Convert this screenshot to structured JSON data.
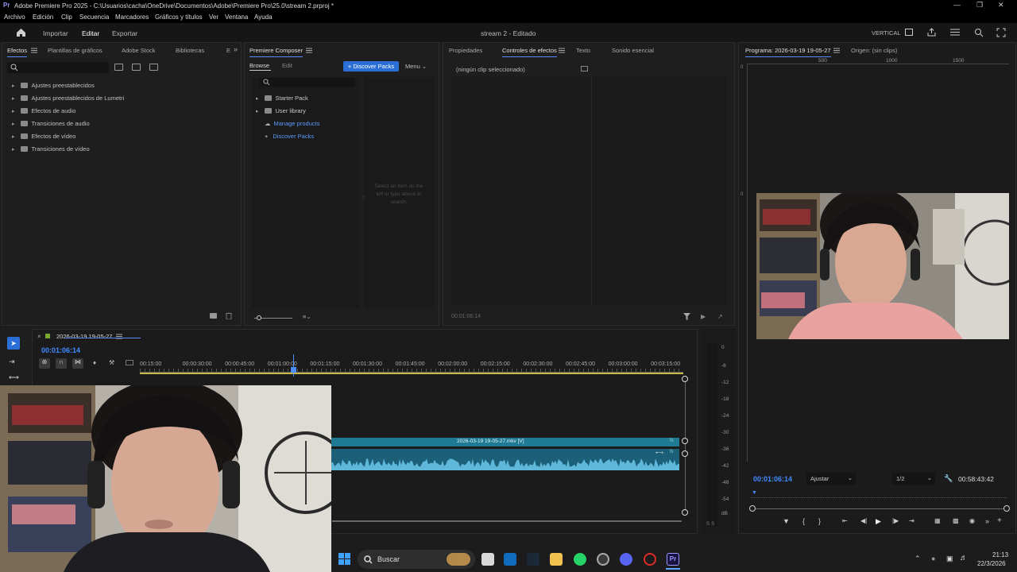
{
  "window": {
    "app_badge": "Pr",
    "title": "Adobe Premiere Pro 2025 - C:\\Usuarios\\cacha\\OneDrive\\Documentos\\Adobe\\Premiere Pro\\25.0\\stream 2.prproj *"
  },
  "menu": [
    "Archivo",
    "Edición",
    "Clip",
    "Secuencia",
    "Marcadores",
    "Gráficos y títulos",
    "Ver",
    "Ventana",
    "Ayuda"
  ],
  "workspace": {
    "import": "Importar",
    "edit": "Editar",
    "export": "Exportar",
    "project_title": "stream 2 - Editado",
    "vertical": "VERTICAL"
  },
  "effects_panel": {
    "tabs": [
      "Efectos",
      "Plantillas de gráficos",
      "Adobe Stock",
      "Bibliotecas",
      "E"
    ],
    "items": [
      "Ajustes preestablecidos",
      "Ajustes preestablecidos de Lumetri",
      "Efectos de audio",
      "Transiciones de audio",
      "Efectos de vídeo",
      "Transiciones de vídeo"
    ]
  },
  "composer_panel": {
    "title": "Premiere Composer",
    "tab_browse": "Browse",
    "tab_edit": "Edit",
    "discover_button": "+ Discover Packs",
    "menu_label": "Menu",
    "items": [
      {
        "label": "Starter Pack",
        "link": false
      },
      {
        "label": "User library",
        "link": false
      },
      {
        "label": "Manage products",
        "link": true
      },
      {
        "label": "Discover Packs",
        "link": true
      }
    ],
    "empty_hint": "Select an item on the left or type above to search."
  },
  "effect_controls": {
    "tabs": [
      "Propiedades",
      "Controles de efectos",
      "Texto",
      "Sonido esencial"
    ],
    "no_clip": "(ningún clip seleccionado)",
    "timecode": "00:01:06:14"
  },
  "program_monitor": {
    "tab_program": "Programa: 2026-03-19 19-05-27",
    "tab_source": "Origen: (sin clips)",
    "ruler": [
      "500",
      "1000",
      "1500"
    ],
    "timecode": "00:01:06:14",
    "fit": "Ajustar",
    "resolution": "1/2",
    "duration": "00:58:43:42"
  },
  "timeline": {
    "sequence_name": "2026-03-19 19-05-27",
    "timecode": "00:01:06:14",
    "ruler": [
      "00:15:00",
      "00:00:30:00",
      "00:00:45:00",
      "00:01:00:00",
      "00:01:15:00",
      "00:01:30:00",
      "00:01:45:00",
      "00:02:00:00",
      "00:02:15:00",
      "00:02:30:00",
      "00:02:45:00",
      "00:03:00:00",
      "00:03:15:00"
    ],
    "clip_label": "2026-03-19 19-05-27.mkv [V]",
    "playhead_fraction": 0.282
  },
  "audio_meter": {
    "labels": [
      "0",
      "-6",
      "-12",
      "-18",
      "-24",
      "-30",
      "-36",
      "-42",
      "-48",
      "-54",
      "dB"
    ],
    "solo": "S S"
  },
  "taskbar": {
    "search": "Buscar",
    "time": "21:13",
    "date": "22/3/2026"
  },
  "colors": {
    "accent_blue": "#2b6fd6",
    "timecode_blue": "#3f8bff",
    "clip_teal": "#1f7a94",
    "audio_wave": "#5fb7d9"
  }
}
